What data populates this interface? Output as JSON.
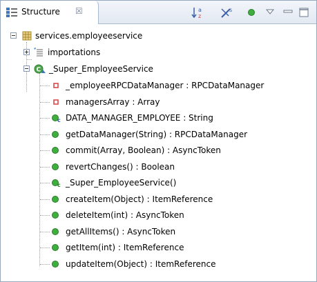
{
  "view": {
    "tab_label": "Structure",
    "close_glyph": "☒"
  },
  "toolbar": {
    "icons": [
      "sort-alphabetically-icon",
      "hide-static-members-icon",
      "show-public-only-icon",
      "view-menu-icon",
      "minimize-icon",
      "maximize-icon"
    ]
  },
  "tree": {
    "package": "services.employeeservice",
    "importations": "importations",
    "class": "_Super_EmployeeService",
    "members": [
      {
        "label": "_employeeRPCDataManager : RPCDataManager",
        "kind": "private-field"
      },
      {
        "label": "managersArray : Array",
        "kind": "private-field"
      },
      {
        "label": "DATA_MANAGER_EMPLOYEE : String",
        "kind": "constant"
      },
      {
        "label": "getDataManager(String) : RPCDataManager",
        "kind": "public-method"
      },
      {
        "label": "commit(Array, Boolean) : AsyncToken",
        "kind": "public-method"
      },
      {
        "label": "revertChanges() : Boolean",
        "kind": "public-method"
      },
      {
        "label": "_Super_EmployeeService()",
        "kind": "constructor"
      },
      {
        "label": "createItem(Object) : ItemReference",
        "kind": "public-method"
      },
      {
        "label": "deleteItem(int) : AsyncToken",
        "kind": "public-method"
      },
      {
        "label": "getAllItems() : AsyncToken",
        "kind": "public-method"
      },
      {
        "label": "getItem(int) : ItemReference",
        "kind": "public-method"
      },
      {
        "label": "updateItem(Object) : ItemReference",
        "kind": "public-method"
      }
    ]
  },
  "colors": {
    "method_green": "#3fae3f",
    "field_red": "#d84a4a",
    "package_tan": "#c8a24a"
  }
}
